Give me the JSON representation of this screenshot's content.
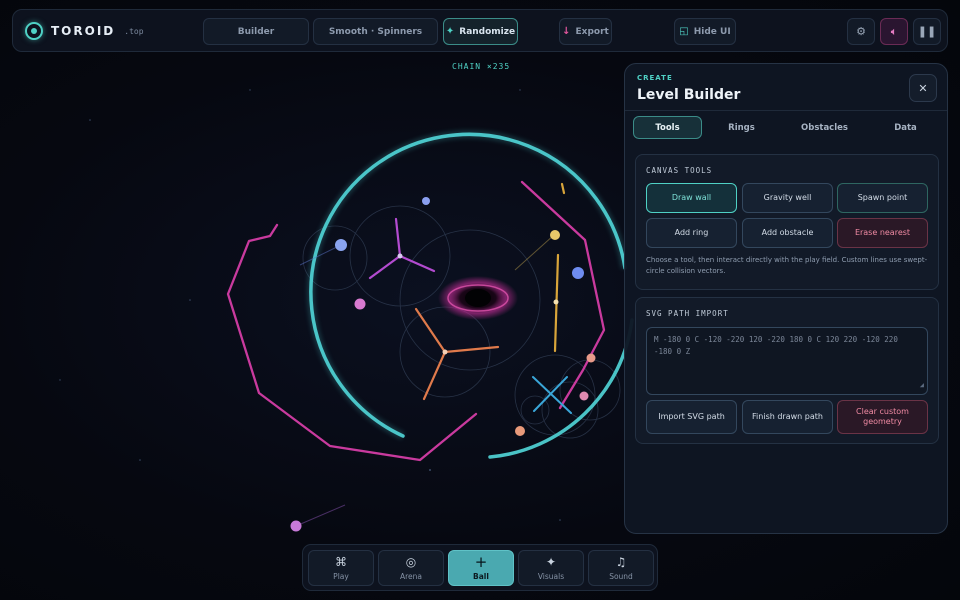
{
  "app": {
    "name": "TOROID",
    "domain": ".top"
  },
  "topbar": {
    "buttons": {
      "builder": "Builder",
      "preset": "Smooth · Spinners",
      "randomize": "Randomize",
      "export": "Export",
      "hide_ui": "Hide UI"
    },
    "icons": {
      "randomize": "sparkle-icon",
      "export": "download-icon",
      "hide_ui": "window-icon",
      "settings": "gear-icon",
      "sound": "speaker-icon",
      "pause": "pause-icon"
    }
  },
  "hud": {
    "chain": "CHAIN ×235"
  },
  "panel": {
    "kicker": "CREATE",
    "title": "Level Builder",
    "tabs": [
      "Tools",
      "Rings",
      "Obstacles",
      "Data"
    ],
    "active_tab": "Tools",
    "canvas_tools": {
      "title": "CANVAS TOOLS",
      "tools": [
        "Draw wall",
        "Gravity well",
        "Spawn point",
        "Add ring",
        "Add obstacle",
        "Erase nearest"
      ],
      "active_tool": "Draw wall",
      "help": "Choose a tool, then interact directly with the play field. Custom lines use swept-circle collision vectors."
    },
    "svg_import": {
      "title": "SVG PATH IMPORT",
      "path_value": "M -180 0 C -120 -220 120 -220 180 0 C 120 220 -120 220 -180 0 Z",
      "buttons": [
        "Import SVG path",
        "Finish drawn path",
        "Clear custom geometry"
      ]
    }
  },
  "dock": [
    {
      "label": "Play",
      "icon": "command-icon",
      "glyph": "⌘"
    },
    {
      "label": "Arena",
      "icon": "target-icon",
      "glyph": "◎"
    },
    {
      "label": "Ball",
      "icon": "plus-icon",
      "glyph": "+"
    },
    {
      "label": "Visuals",
      "icon": "sparkle-icon",
      "glyph": "✦"
    },
    {
      "label": "Sound",
      "icon": "music-note-icon",
      "glyph": "♫"
    }
  ],
  "active_dock": "Ball",
  "colors": {
    "accent": "#4fd1c5",
    "wall": "#c93a9e",
    "background": "#05070d"
  }
}
